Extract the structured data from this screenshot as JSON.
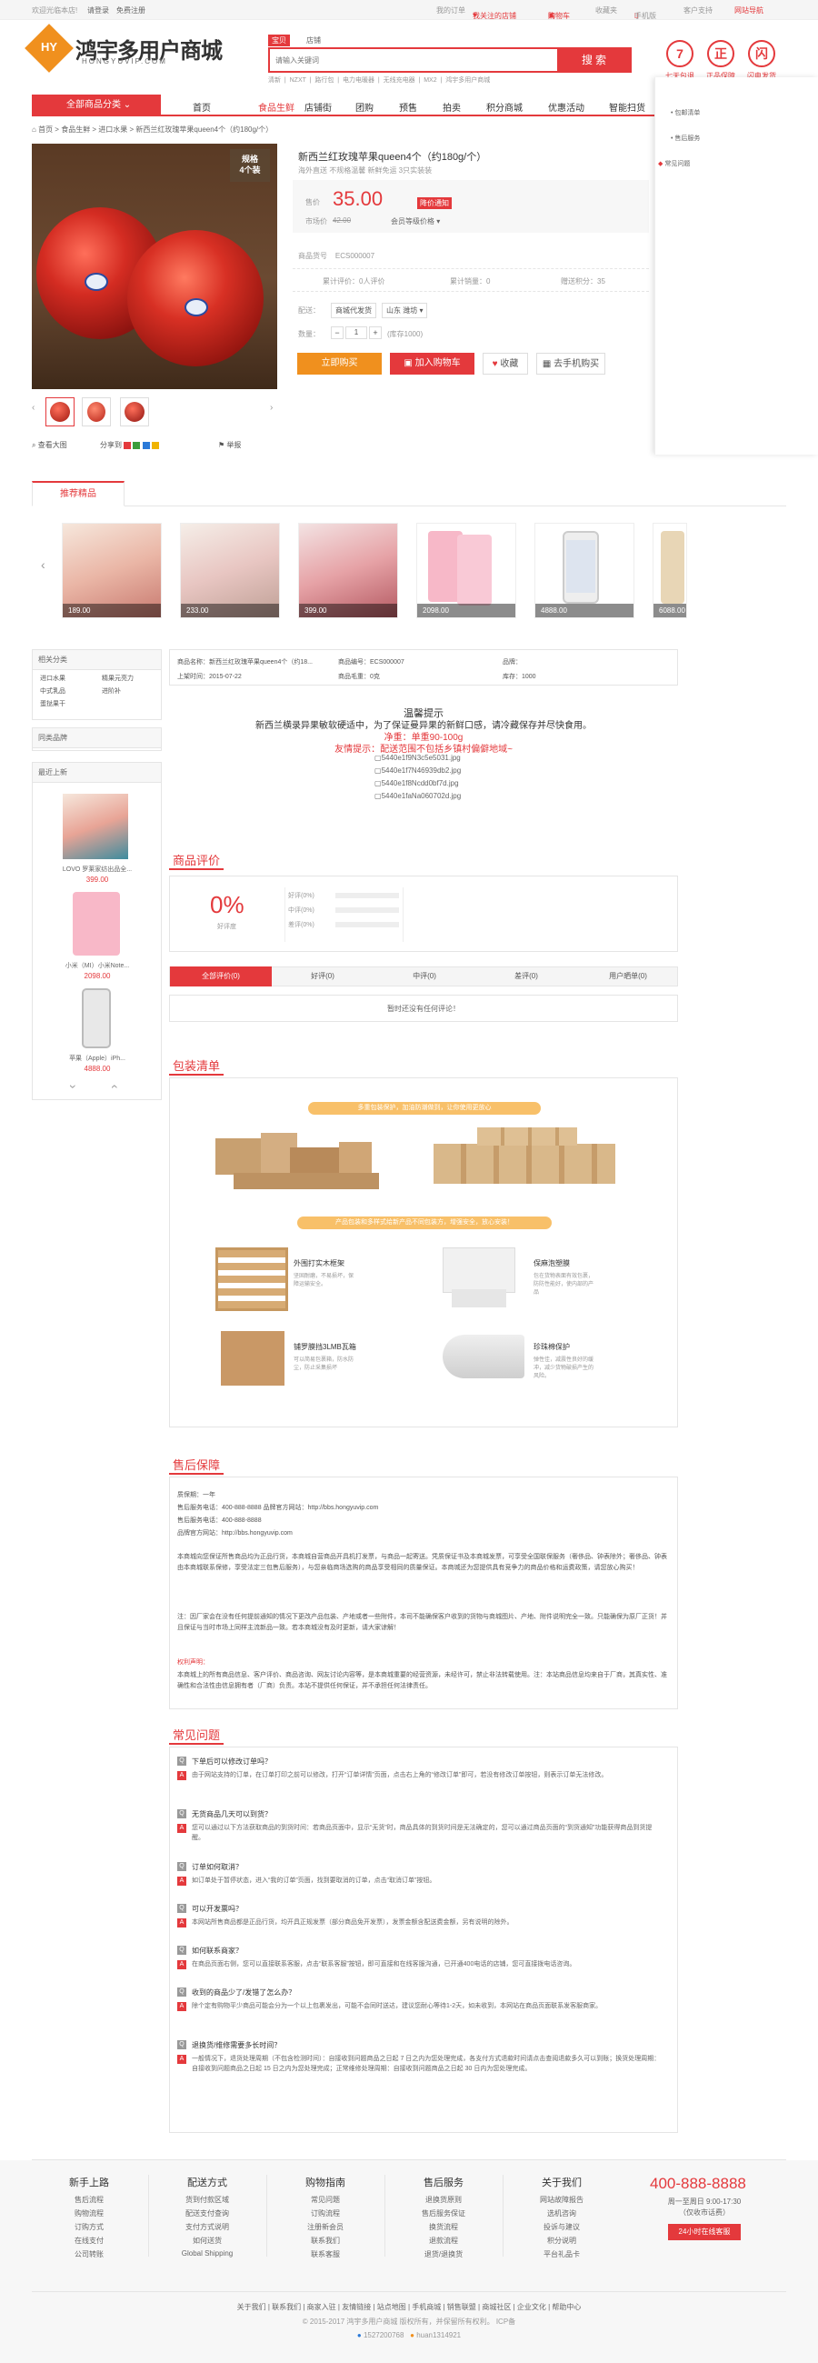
{
  "topbar": {
    "welcome": "欢迎光临本店!",
    "login": "请登录",
    "register": "免费注册",
    "my_order": "我的订单",
    "favorites": "我关注的店铺",
    "cart": "购物车",
    "fav_site": "收藏夹",
    "mobile": "手机版",
    "customer": "客户支持",
    "site_nav": "网站导航"
  },
  "logo": {
    "mark": "HY",
    "name": "鸿宇多用户商城",
    "domain": "HONGYUVIP.COM"
  },
  "search": {
    "tab_goods": "宝贝",
    "tab_shop": "店铺",
    "placeholder": "请输入关键词",
    "button": "搜索",
    "hot": [
      "清新",
      "NZXT",
      "路行包",
      "电力电暖器",
      "无线充电器",
      "MX2",
      "鸿宇多用户商城"
    ]
  },
  "services": [
    {
      "icon": "7",
      "label": "七天包退"
    },
    {
      "icon": "正",
      "label": "正品保障"
    },
    {
      "icon": "闪",
      "label": "闪电发货"
    }
  ],
  "nav": {
    "all_categories": "全部商品分类",
    "items": [
      "首页",
      "食品生鲜",
      "店铺街",
      "团购",
      "预售",
      "拍卖",
      "积分商城",
      "优惠活动",
      "智能扫货",
      "文"
    ]
  },
  "side_panel": {
    "items": [
      "包邮清单",
      "售后服务",
      "常见问题"
    ]
  },
  "breadcrumb": "首页 > 食品生鲜 > 进口水果 > 新西兰红玫瑰苹果queen4个（约180g/个）",
  "product": {
    "badge_line1": "规格",
    "badge_line2": "4个装",
    "title": "新西兰红玫瑰苹果queen4个（约180g/个）",
    "subtitle": "海外直送 不规格温馨 新鲜免运 3只实装装",
    "price_label": "售价",
    "price": "35.00",
    "price_notice": "降价通知",
    "market_label": "市场价",
    "market_price": "42.00",
    "member_price": "会员等级价格 ▾",
    "sn_label": "商品货号",
    "sn": "ECS000007",
    "stat1": "累计评价：0人评价",
    "stat2": "累计销量：0",
    "stat3": "赠送积分：35",
    "ship_label": "配送：",
    "ship_to": "商城代发货",
    "region": "山东 潍坊 ▾",
    "qty_label": "数量：",
    "qty": "1",
    "stock": "(库存1000)",
    "buy_now": "立即购买",
    "add_cart": "加入购物车",
    "fav": "收藏",
    "mobile_buy": "去手机购买",
    "view_big": "查看大图",
    "share": "分享到",
    "report": "举报"
  },
  "recommend": {
    "title": "推荐精品",
    "prices": [
      "189.00",
      "233.00",
      "399.00",
      "2098.00",
      "4888.00",
      "6088.00"
    ]
  },
  "left": {
    "cat_title": "相关分类",
    "cats": [
      "进口水果",
      "精果元亮力",
      "中式乳品",
      "进阶补",
      "蛋挞果干"
    ],
    "brand_title": "同类品牌",
    "new_title": "最近上新",
    "new_items": [
      {
        "name": "LOVO 罗莱家纺出品全...",
        "price": "399.00"
      },
      {
        "name": "小米（MI）小米Note...",
        "price": "2098.00"
      },
      {
        "name": "苹果（Apple）iPh...",
        "price": "4888.00"
      }
    ]
  },
  "attrs": {
    "name": "商品名称：新西兰红玫瑰苹果queen4个（约18...",
    "sn": "商品编号：ECS000007",
    "brand": "品牌：",
    "date": "上架时间：2015-07-22",
    "weight": "商品毛重：0克",
    "stock": "库存：1000"
  },
  "desc": {
    "h1": "温馨提示",
    "h2": "新西兰横录异果敏软硬适中，为了保证曼异果的新鲜口感，请冷藏保存并尽快食用。",
    "net": "净重：单重90-100g",
    "tip": "友情提示：配送范围不包括乡镇村偏僻地域~",
    "imgs": [
      "5440e1f9N3c5e5031.jpg",
      "5440e1f7N46939db2.jpg",
      "5440e1f8Ncdd0bf7d.jpg",
      "5440e1faNa060702d.jpg"
    ]
  },
  "reviews": {
    "title": "商品评价",
    "percent": "0%",
    "good": "好评度",
    "rows": [
      "好评(0%)",
      "中评(0%)",
      "差评(0%)"
    ],
    "tabs": [
      "全部评价(0)",
      "好评(0)",
      "中评(0)",
      "差评(0)",
      "用户晒单(0)"
    ],
    "empty": "暂时还没有任何评论！"
  },
  "packing": {
    "title": "包装清单",
    "banner1": "多重包装保护，加油防潮做到，让你使用更放心",
    "banner2": "产品包装和多样式给新产品不同包装方，增强安全，放心安装！",
    "items": [
      {
        "t": "外围打实木框架",
        "d": "坚固耐磨，不易损坏，保障运输安全。"
      },
      {
        "t": "保麻泡塑膜",
        "d": "包在货物表面有效包裹，防防性能好，使内部的产品"
      },
      {
        "t": "铺罗膜挡3LMB瓦箱",
        "d": "可以简易包裹箱，防水防尘，防止采集损坏"
      },
      {
        "t": "珍珠棉保护",
        "d": "弹性佳，减震性良好的缓冲，减少货物破损产生的风险。"
      }
    ]
  },
  "after_sale": {
    "title": "售后保障",
    "lines": [
      "质保期：一年",
      "售后服务电话：400-888-8888 品牌官方网站：http://bbs.hongyuvip.com",
      "售后服务电话：400-888-8888",
      "品牌官方网站：http://bbs.hongyuvip.com"
    ],
    "p1": "本商城向您保证所售商品均为正品行货，本商城自营商品开具机打发票，与商品一起寄送。凭质保证书及本商城发票，可享受全国联保服务（奢侈品、钟表除外；奢侈品、钟表由本商城联系保修，享受法定三包售后服务），与您亲临商场选购的商品享受相同的质量保证。本商城还为您提供具有竞争力的商品价格和运费政策，请您放心购买！",
    "p2": "注：因厂家会在没有任何提前通知的情况下更改产品包装、产地或者一些附件，本司不能确保客户收到的货物与商城图片、产地、附件说明完全一致。只能确保为原厂正货！并且保证与当时市场上同样主流新品一致。若本商城没有及时更新，请大家谅解！",
    "p3t": "权利声明：",
    "p3": "本商城上的所有商品信息、客户评价、商品咨询、网友讨论内容等，是本商城重要的经营资源，未经许可，禁止非法转载使用。注：本站商品信息均来自于厂商，其真实性、准确性和合法性由信息拥有者（厂商）负责。本站不提供任何保证，并不承担任何法律责任。"
  },
  "faq": {
    "title": "常见问题",
    "items": [
      {
        "q": "下单后可以修改订单吗？",
        "a": "由于网站支持的订单，在订单打印之前可以修改，打开“订单详情”页面，点击右上角的“修改订单”即可，若没有修改订单按钮，则表示订单无法修改。"
      },
      {
        "q": "无货商品几天可以到货？",
        "a": "您可以通过以下方法获取商品的到货时间：若商品页面中，显示“无货”时，商品具体的到货时间是无法确定的，您可以通过商品页面的“到货通知”功能获得商品到货提醒。"
      },
      {
        "q": "订单如何取消？",
        "a": "如订单处于暂停状态，进入“我的订单”页面，找到要取消的订单，点击“取消订单”按钮。"
      },
      {
        "q": "可以开发票吗？",
        "a": "本网站所售商品都是正品行货，均开具正规发票（部分商品免开发票），发票金额含配送费金额，另有说明的除外。"
      },
      {
        "q": "如何联系商家？",
        "a": "在商品页面右侧，您可以直接联系客服，点击“联系客服”按钮，即可直接和在线客服沟通，已开通400电话的店铺，您可直接拨电话咨询。"
      },
      {
        "q": "收到的商品少了/发错了怎么办？",
        "a": "除个定有购物平少商品可能会分为一个以上包裹发出，可能不会同时送达，建议您耐心等待1-2天，如未收到，本网站在商品页面联系发客服商家。"
      },
      {
        "q": "退换货/维修需要多长时间？",
        "a": "一般情况下，退货处理周期（不包含检测时间）：自接收到问题商品之日起 7 日之内为您处理完成，各支付方式退款时间请点击查阅退款多久可以到账；换货处理周期：自接收到问题商品之日起 15 日之内为您处理完成；正常维修处理周期：自接收到问题商品之日起 30 日内为您处理完成。"
      }
    ]
  },
  "footer": {
    "cols": [
      {
        "h": "新手上路",
        "i": [
          "售后流程",
          "购物流程",
          "订购方式",
          "在线支付",
          "公司转账"
        ]
      },
      {
        "h": "配送方式",
        "i": [
          "货到付款区域",
          "配送支付查询",
          "支付方式说明",
          "如何送货",
          "Global Shipping"
        ]
      },
      {
        "h": "购物指南",
        "i": [
          "常见问题",
          "订购流程",
          "注册新会员",
          "联系我们",
          "联系客服"
        ]
      },
      {
        "h": "售后服务",
        "i": [
          "退换货原则",
          "售后服务保证",
          "换货流程",
          "退款流程",
          "退货/退换货"
        ]
      },
      {
        "h": "关于我们",
        "i": [
          "网站故障报告",
          "选机咨询",
          "投诉与建议",
          "积分说明",
          "平台礼品卡"
        ]
      }
    ],
    "phone": "400-888-8888",
    "hours": "周一至周日 9:00-17:30",
    "hours2": "（仅收市话费）",
    "online": "24小时在线客服",
    "links": [
      "关于我们",
      "联系我们",
      "商家入驻",
      "友情链接",
      "站点地图",
      "手机商城",
      "销售联盟",
      "商城社区",
      "企业文化",
      "帮助中心"
    ],
    "copyright": "© 2015-2017 鸿宇多用户商城 版权所有，并保留所有权利。 ICP备",
    "qq": "1527200768",
    "ww": "huan1314921"
  },
  "colors": {
    "accent": "#e4393c",
    "orange": "#f0901e"
  }
}
